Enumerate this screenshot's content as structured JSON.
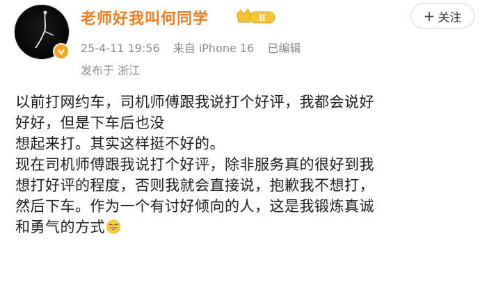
{
  "author": {
    "name": "老师好我叫何同学",
    "level_badge": "Ⅱ"
  },
  "meta": {
    "date": "25-4-11 19:56",
    "device": "来自 iPhone 16",
    "edited": "已编辑",
    "location": "发布于 浙江"
  },
  "follow_label": "关注",
  "content": {
    "lines": [
      "以前打网约车，司机师傅跟我说打个好评，我都会说好",
      "好好，但是下车后也没",
      "想起来打。其实这样挺不好的。",
      "现在司机师傅跟我说打个好评，除非服务真的很好到我",
      "想打好评的程度，否则我就会直接说，抱歉我不想打，",
      "然后下车。作为一个有讨好倾向的人，这是我锻炼真诚",
      "和勇气的方式"
    ]
  },
  "colors": {
    "username": "#f07b20",
    "meta": "#8a8a8a",
    "badge": "#f7a21b"
  },
  "icons": {
    "avatar": "avatar-image",
    "verify": "verified-badge-icon",
    "level": "crown-level-icon",
    "emoji": "grinning-sweat-emoji"
  }
}
